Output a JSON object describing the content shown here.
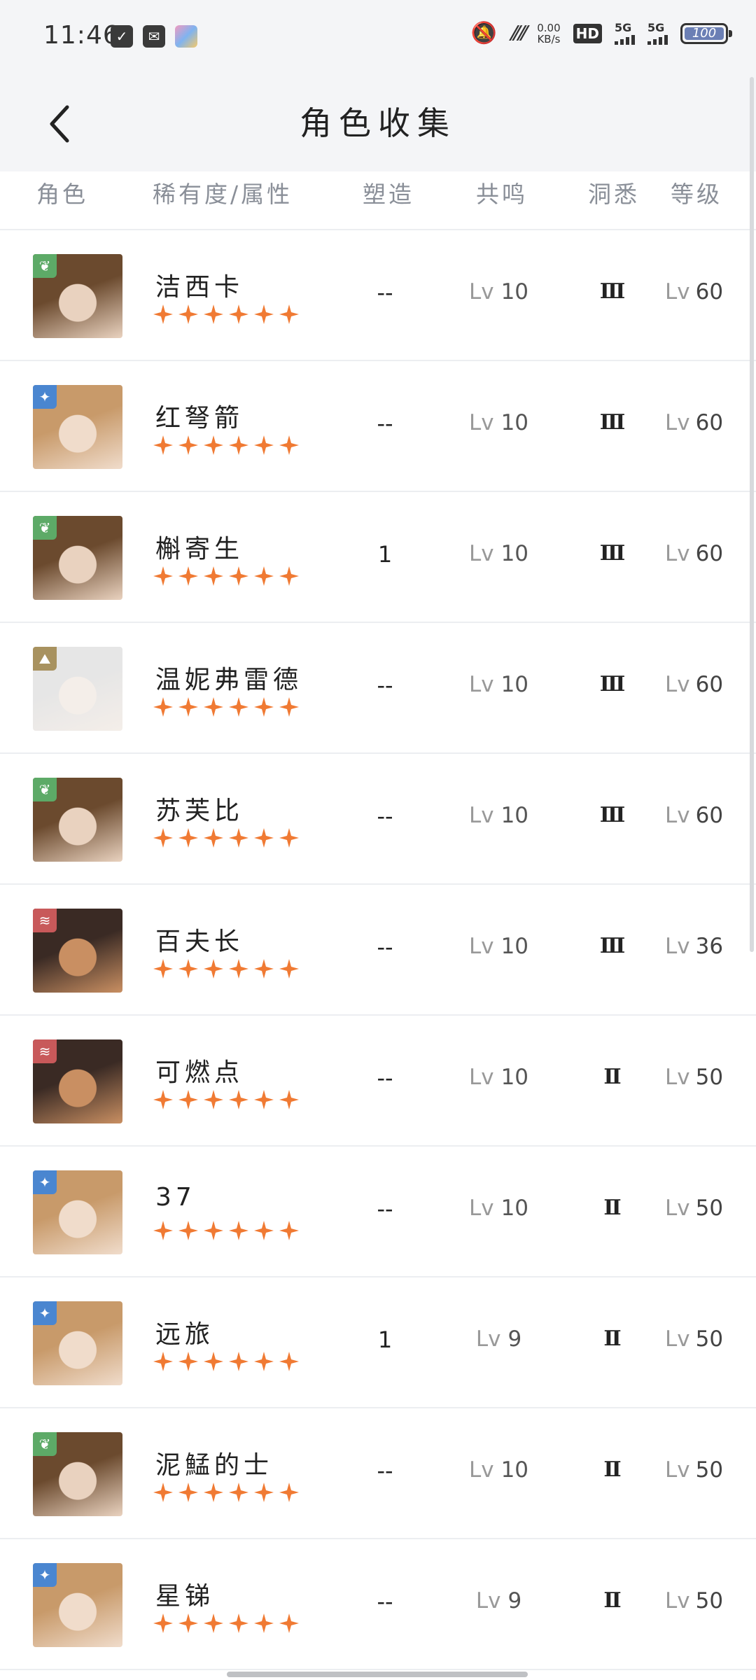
{
  "status_bar": {
    "time": "11:46",
    "net_speed": "0.00",
    "net_unit": "KB/s",
    "hd_label": "HD",
    "sim1_label": "5G",
    "sim2_label": "5G",
    "battery": "100"
  },
  "header": {
    "title": "角色收集",
    "back_icon": "chevron-left-icon"
  },
  "table": {
    "columns": {
      "role": "角色",
      "rarity": "稀有度/属性",
      "shape": "塑造",
      "resonance": "共鸣",
      "insight": "洞悉",
      "level": "等级"
    },
    "level_prefix": "Lv",
    "star_color": "#f07a33",
    "rows": [
      {
        "name": "洁西卡",
        "element": "green",
        "shape": "--",
        "resonance": "10",
        "insight": "Ⅲ",
        "level": "60"
      },
      {
        "name": "红弩箭",
        "element": "blue",
        "shape": "--",
        "resonance": "10",
        "insight": "Ⅲ",
        "level": "60"
      },
      {
        "name": "槲寄生",
        "element": "green",
        "shape": "1",
        "resonance": "10",
        "insight": "Ⅲ",
        "level": "60"
      },
      {
        "name": "温妮弗雷德",
        "element": "gold",
        "shape": "--",
        "resonance": "10",
        "insight": "Ⅲ",
        "level": "60"
      },
      {
        "name": "苏芙比",
        "element": "green",
        "shape": "--",
        "resonance": "10",
        "insight": "Ⅲ",
        "level": "60"
      },
      {
        "name": "百夫长",
        "element": "red",
        "shape": "--",
        "resonance": "10",
        "insight": "Ⅲ",
        "level": "36"
      },
      {
        "name": "可燃点",
        "element": "red",
        "shape": "--",
        "resonance": "10",
        "insight": "Ⅱ",
        "level": "50"
      },
      {
        "name": "37",
        "element": "blue",
        "shape": "--",
        "resonance": "10",
        "insight": "Ⅱ",
        "level": "50"
      },
      {
        "name": "远旅",
        "element": "blue",
        "shape": "1",
        "resonance": "9",
        "insight": "Ⅱ",
        "level": "50"
      },
      {
        "name": "泥鯭的士",
        "element": "green",
        "shape": "--",
        "resonance": "10",
        "insight": "Ⅱ",
        "level": "50"
      },
      {
        "name": "星锑",
        "element": "blue",
        "shape": "--",
        "resonance": "9",
        "insight": "Ⅱ",
        "level": "50"
      }
    ]
  }
}
